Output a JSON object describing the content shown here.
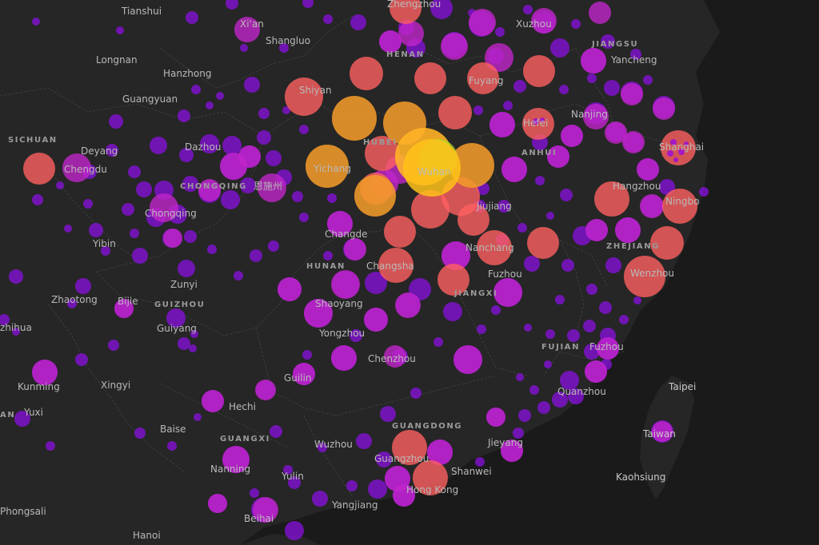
{
  "map": {
    "colors": {
      "background": "#1b1b1b",
      "land": "#262626",
      "sea": "#1a1a1a",
      "boundary": "#3d3d3d",
      "label": "#b9b9b9",
      "bubble_low": "#8a10e0",
      "bubble_mid": "#e0309a",
      "bubble_high": "#ff6a5a",
      "bubble_peak": "#ffc21a",
      "bubble_top_core": "#a8e02a"
    },
    "province_labels": [
      {
        "id": "sichuan",
        "text": "SICHUAN"
      },
      {
        "id": "chongqing",
        "text": "CHONGQING"
      },
      {
        "id": "guizhou",
        "text": "GUIZHOU"
      },
      {
        "id": "hunan",
        "text": "HUNAN"
      },
      {
        "id": "hubei",
        "text": "HUBEI"
      },
      {
        "id": "henan",
        "text": "HENAN"
      },
      {
        "id": "anhui",
        "text": "ANHUI"
      },
      {
        "id": "jiangsu",
        "text": "JIANGSU"
      },
      {
        "id": "zhejiang",
        "text": "ZHEJIANG"
      },
      {
        "id": "jiangxi",
        "text": "JIANGXI"
      },
      {
        "id": "fujian",
        "text": "FUJIAN"
      },
      {
        "id": "guangdong",
        "text": "GUANGDONG"
      },
      {
        "id": "guangxi",
        "text": "GUANGXI"
      }
    ],
    "city_labels": [
      {
        "id": "tianshui",
        "text": "Tianshui"
      },
      {
        "id": "xian",
        "text": "Xi'an"
      },
      {
        "id": "shangluo",
        "text": "Shangluo"
      },
      {
        "id": "zhengzhou",
        "text": "Zhengzhou"
      },
      {
        "id": "xuzhou",
        "text": "Xuzhou"
      },
      {
        "id": "longnan",
        "text": "Longnan"
      },
      {
        "id": "hanzhong",
        "text": "Hanzhong"
      },
      {
        "id": "yancheng",
        "text": "Yancheng"
      },
      {
        "id": "fuyang",
        "text": "Fuyang"
      },
      {
        "id": "shiyan",
        "text": "Shiyan"
      },
      {
        "id": "guangyuan",
        "text": "Guangyuan"
      },
      {
        "id": "hefei",
        "text": "Hefei"
      },
      {
        "id": "nanjing",
        "text": "Nanjing"
      },
      {
        "id": "shanghai",
        "text": "Shanghai"
      },
      {
        "id": "deyang",
        "text": "Deyang"
      },
      {
        "id": "dazhou",
        "text": "Dazhou"
      },
      {
        "id": "chengdu",
        "text": "Chengdu"
      },
      {
        "id": "yichang",
        "text": "Yichang"
      },
      {
        "id": "wuhan",
        "text": "Wuhan"
      },
      {
        "id": "enshi",
        "text": "恩施州"
      },
      {
        "id": "hangzhou",
        "text": "Hangzhou"
      },
      {
        "id": "ningbo",
        "text": "Ningbo"
      },
      {
        "id": "chongqing_city",
        "text": "Chongqing"
      },
      {
        "id": "jiujiang",
        "text": "Jiujiang"
      },
      {
        "id": "changde",
        "text": "Changde"
      },
      {
        "id": "yibin",
        "text": "Yibin"
      },
      {
        "id": "nanchang",
        "text": "Nanchang"
      },
      {
        "id": "changsha",
        "text": "Changsha"
      },
      {
        "id": "fuzhou_jx",
        "text": "Fuzhou"
      },
      {
        "id": "wenzhou",
        "text": "Wenzhou"
      },
      {
        "id": "zunyi",
        "text": "Zunyi"
      },
      {
        "id": "zhaotong",
        "text": "Zhaotong"
      },
      {
        "id": "bijie",
        "text": "Bijie"
      },
      {
        "id": "shaoyang",
        "text": "Shaoyang"
      },
      {
        "id": "yongzhou",
        "text": "Yongzhou"
      },
      {
        "id": "guiyang",
        "text": "Guiyang"
      },
      {
        "id": "zhihua",
        "text": "zhihua"
      },
      {
        "id": "fuzhou_fj",
        "text": "Fuzhou"
      },
      {
        "id": "chenzhou",
        "text": "Chenzhou"
      },
      {
        "id": "kunming",
        "text": "Kunming"
      },
      {
        "id": "xingyi",
        "text": "Xingyi"
      },
      {
        "id": "guilin",
        "text": "Guilin"
      },
      {
        "id": "taipei",
        "text": "Taipei"
      },
      {
        "id": "quanzhou",
        "text": "Quanzhou"
      },
      {
        "id": "yuxi",
        "text": "Yuxi"
      },
      {
        "id": "an",
        "text": "AN"
      },
      {
        "id": "hechi",
        "text": "Hechi"
      },
      {
        "id": "baise",
        "text": "Baise"
      },
      {
        "id": "taiwan",
        "text": "Taiwan"
      },
      {
        "id": "wuzhou",
        "text": "Wuzhou"
      },
      {
        "id": "jieyang",
        "text": "Jieyang"
      },
      {
        "id": "guangzhou",
        "text": "Guangzhou"
      },
      {
        "id": "shanwei",
        "text": "Shanwei"
      },
      {
        "id": "nanning",
        "text": "Nanning"
      },
      {
        "id": "yulin",
        "text": "Yulin"
      },
      {
        "id": "kaohsiung",
        "text": "Kaohsiung"
      },
      {
        "id": "hongkong",
        "text": "Hong Kong"
      },
      {
        "id": "fangchenggang",
        "text": "Phongsali"
      },
      {
        "id": "yangjiang",
        "text": "Yangjiang"
      },
      {
        "id": "beihai",
        "text": "Beihai"
      },
      {
        "id": "hanoi",
        "text": "Hanoi"
      }
    ]
  }
}
